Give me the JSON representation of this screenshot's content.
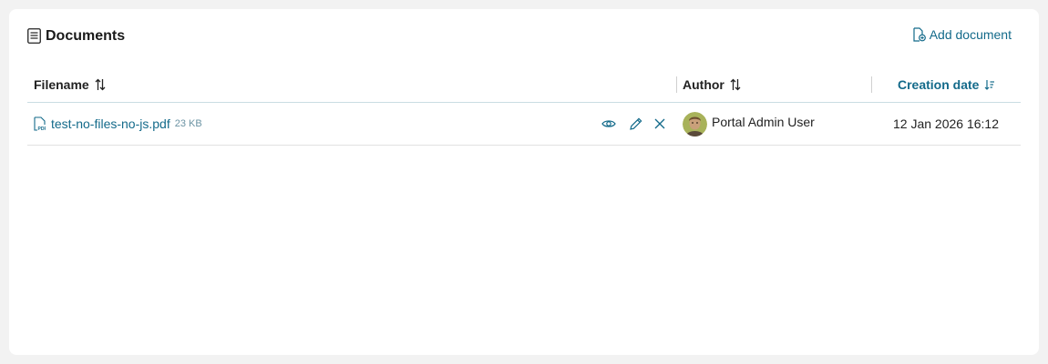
{
  "header": {
    "title": "Documents",
    "add_label": "Add document"
  },
  "table": {
    "columns": {
      "filename": "Filename",
      "author": "Author",
      "creation_date": "Creation date"
    },
    "rows": [
      {
        "filename": "test-no-files-no-js.pdf",
        "size": "23 KB",
        "author": "Portal Admin User",
        "created": "12 Jan 2026 16:12"
      }
    ]
  },
  "colors": {
    "accent": "#136a8a",
    "size_text": "#6b93a3",
    "header_border": "#c9dde3",
    "row_border": "#e2e2e2"
  },
  "icons": {
    "title": "document-list-icon",
    "add": "add-document-icon",
    "sort_filename": "sort-icon",
    "sort_author": "sort-icon",
    "sort_date": "sort-descending-icon",
    "file": "pdf-file-icon",
    "view": "eye-icon",
    "edit": "pencil-icon",
    "delete": "close-icon"
  }
}
